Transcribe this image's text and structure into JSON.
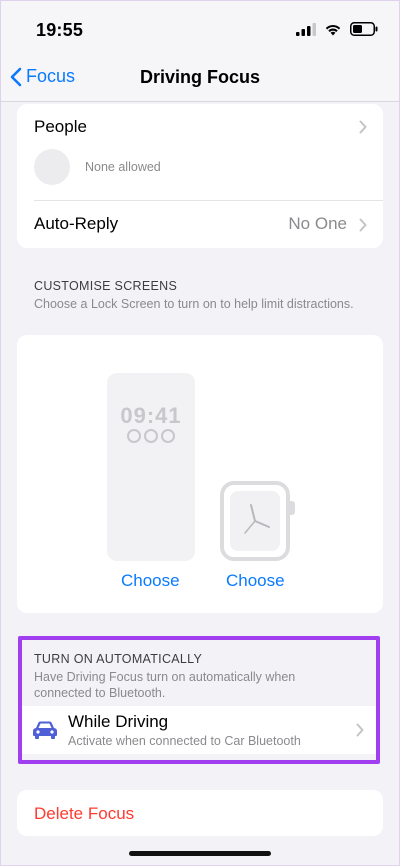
{
  "status_bar": {
    "time": "19:55"
  },
  "nav": {
    "back_label": "Focus",
    "title": "Driving Focus"
  },
  "people": {
    "label": "People",
    "none_allowed": "None allowed"
  },
  "auto_reply": {
    "label": "Auto-Reply",
    "value": "No One"
  },
  "customise": {
    "header": "CUSTOMISE SCREENS",
    "note": "Choose a Lock Screen to turn on to help limit distractions.",
    "lock_time": "09:41",
    "choose_phone": "Choose",
    "choose_watch": "Choose"
  },
  "turn_on": {
    "header": "TURN ON AUTOMATICALLY",
    "note": "Have Driving Focus turn on automatically when connected to Bluetooth.",
    "while_driving": "While Driving",
    "while_driving_sub": "Activate when connected to Car Bluetooth"
  },
  "delete": {
    "label": "Delete Focus"
  },
  "colors": {
    "accent": "#0a7aff",
    "destructive": "#ff3b30",
    "highlight": "#a13ef0",
    "car": "#4f5fd6"
  }
}
